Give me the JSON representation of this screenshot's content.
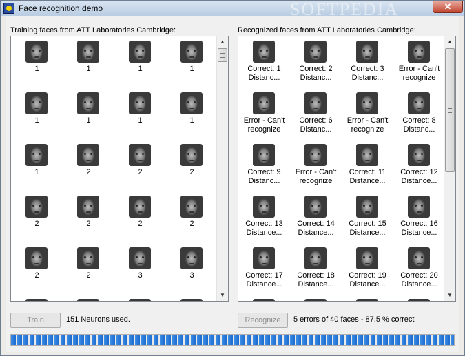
{
  "window": {
    "title": "Face recognition demo",
    "watermark": "SOFTPEDIA",
    "close_label": "✕"
  },
  "training": {
    "label": "Training faces from ATT Laboratories Cambridge:",
    "faces": [
      "1",
      "1",
      "1",
      "1",
      "1",
      "1",
      "1",
      "1",
      "1",
      "2",
      "2",
      "2",
      "2",
      "2",
      "2",
      "2",
      "2",
      "2",
      "3",
      "3"
    ]
  },
  "recognized": {
    "label": "Recognized faces from ATT Laboratories Cambridge:",
    "faces": [
      [
        "Correct: 1",
        "Distanc..."
      ],
      [
        "Correct: 2",
        "Distanc..."
      ],
      [
        "Correct: 3",
        "Distanc..."
      ],
      [
        "Error - Can't",
        "recognize"
      ],
      [
        "Error - Can't",
        "recognize"
      ],
      [
        "Correct: 6",
        "Distanc..."
      ],
      [
        "Error - Can't",
        "recognize"
      ],
      [
        "Correct: 8",
        "Distanc..."
      ],
      [
        "Correct: 9",
        "Distanc..."
      ],
      [
        "Error - Can't",
        "recognize"
      ],
      [
        "Correct: 11",
        "Distance..."
      ],
      [
        "Correct: 12",
        "Distance..."
      ],
      [
        "Correct: 13",
        "Distance..."
      ],
      [
        "Correct: 14",
        "Distance..."
      ],
      [
        "Correct: 15",
        "Distance..."
      ],
      [
        "Correct: 16",
        "Distance..."
      ],
      [
        "Correct: 17",
        "Distance..."
      ],
      [
        "Correct: 18",
        "Distance..."
      ],
      [
        "Correct: 19",
        "Distance..."
      ],
      [
        "Correct: 20",
        "Distance..."
      ]
    ]
  },
  "controls": {
    "train_label": "Train",
    "neurons_status": "151 Neurons used.",
    "recognize_label": "Recognize",
    "result_status": "5 errors of 40 faces - 87.5 % correct"
  },
  "progress": {
    "value_percent": 100
  },
  "scroll": {
    "up_arrow": "▲",
    "down_arrow": "▼"
  }
}
